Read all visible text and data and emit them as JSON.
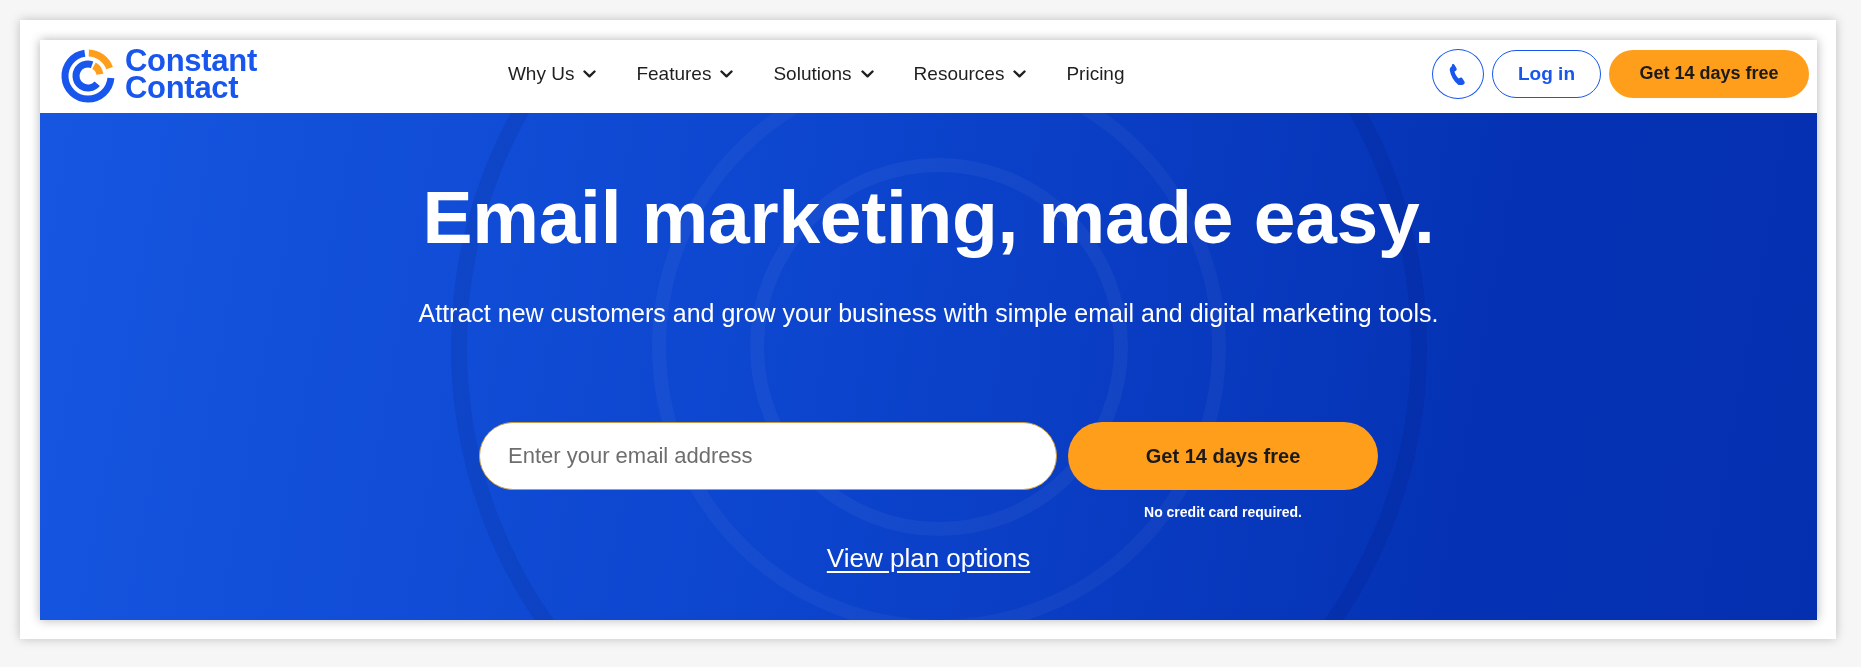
{
  "logo": {
    "lines": [
      "Constant",
      "Contact"
    ]
  },
  "nav": {
    "items": [
      {
        "label": "Why Us",
        "kind": "dropdown"
      },
      {
        "label": "Features",
        "kind": "dropdown"
      },
      {
        "label": "Solutions",
        "kind": "dropdown"
      },
      {
        "label": "Resources",
        "kind": "dropdown"
      },
      {
        "label": "Pricing",
        "kind": "link"
      }
    ]
  },
  "actions": [
    {
      "kind": "phone"
    },
    {
      "kind": "outline",
      "label": "Log in"
    },
    {
      "kind": "primary",
      "label": "Get 14 days free"
    }
  ],
  "hero": {
    "headline": "Email marketing, made easy.",
    "subheadline": "Attract new customers and grow your business with simple email and digital marketing tools.",
    "email_field": {
      "placeholder": "Enter your email address"
    },
    "submit_button": "Get 14 days free",
    "note": "No credit card required.",
    "plan_link": "View plan options"
  }
}
